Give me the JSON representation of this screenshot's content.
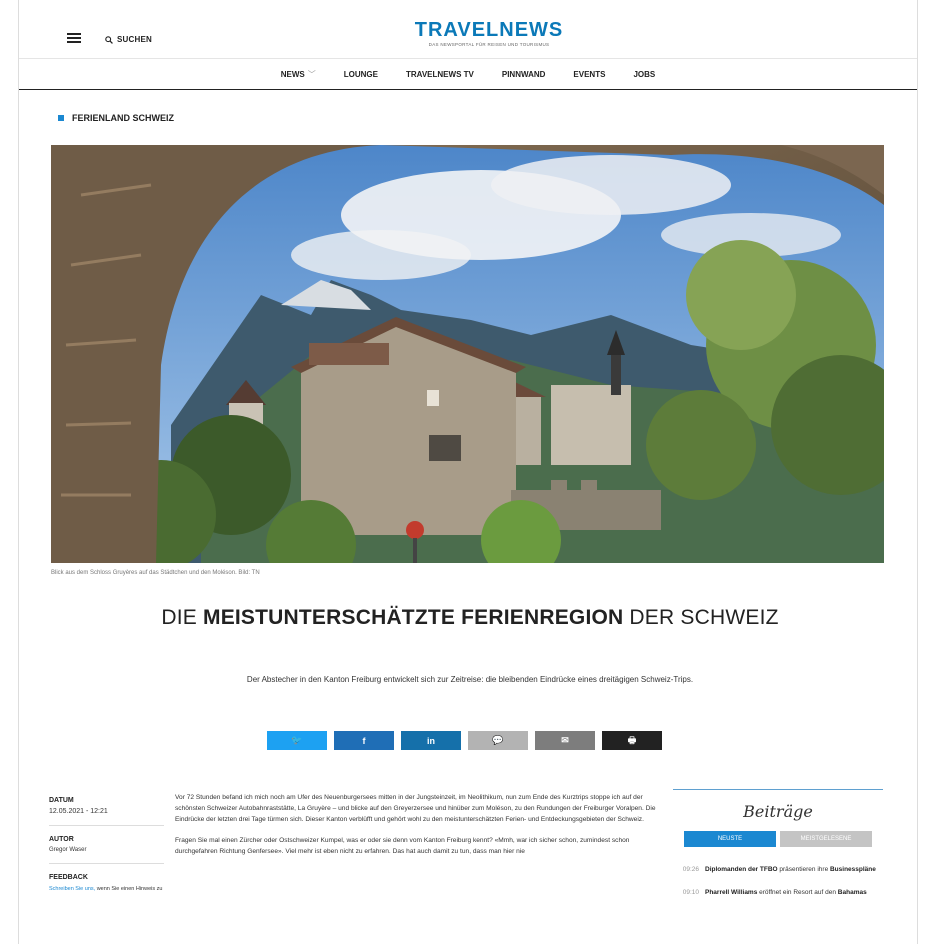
{
  "header": {
    "search_label": "SUCHEN",
    "logo_text": "TRAVELNEWS",
    "logo_sub": "DAS NEWSPORTAL FÜR REISEN UND TOURISMUS"
  },
  "nav": {
    "items": [
      "NEWS",
      "LOUNGE",
      "TRAVELNEWS TV",
      "PINNWAND",
      "EVENTS",
      "JOBS"
    ]
  },
  "section": "FERIENLAND SCHWEIZ",
  "hero": {
    "caption": "Blick aus dem Schloss Gruyères auf das Städtchen und den Moléson. Bild: TN"
  },
  "headline": {
    "pre": "DIE ",
    "strong": "MEISTUNTERSCHÄTZTE FERIENREGION",
    "post": " DER SCHWEIZ"
  },
  "lead": "Der Abstecher in den Kanton Freiburg entwickelt sich zur Zeitreise: die bleibenden Eindrücke eines dreitägigen Schweiz-Trips.",
  "share": {
    "twitter": "🐦",
    "facebook": "f",
    "linkedin": "in",
    "comment": "💬",
    "mail": "✉",
    "print": "🖶",
    "colors": {
      "twitter": "#1da1f2",
      "facebook": "#1f6eb6",
      "linkedin": "#1570aa",
      "comment": "#b3b3b3",
      "mail": "#7d7d7d",
      "print": "#222222"
    }
  },
  "meta": {
    "date_label": "DATUM",
    "date_value": "12.05.2021 - 12:21",
    "author_label": "AUTOR",
    "author_value": "Gregor Waser",
    "feedback_label": "FEEDBACK",
    "feedback_link": "Schreiben Sie uns,",
    "feedback_rest": " wenn Sie einen Hinweis zu"
  },
  "article": {
    "p1": "Vor 72 Stunden befand ich mich noch am Ufer des Neuenburgersees mitten in der Jungsteinzeit, im Neolithikum, nun zum Ende des Kurztrips stoppe ich auf der schönsten Schweizer Autobahnraststätte, La Gruyère – und blicke auf den Greyerzersee und hinüber zum Moléson, zu den Rundungen der Freiburger Voralpen. Die Eindrücke der letzten drei Tage türmen sich. Dieser Kanton verblüfft und gehört wohl zu den meistunterschätzten Ferien- und Entdeckungsgebieten der Schweiz.",
    "p2": "Fragen Sie mal einen Zürcher oder Ostschweizer Kumpel, was er oder sie denn vom Kanton Freiburg kennt? «Mmh, war ich sicher schon, zumindest schon durchgefahren Richtung Genfersee». Viel mehr ist eben nicht zu erfahren. Das hat auch damit zu tun, dass man hier nie"
  },
  "sidebar": {
    "title": "Beiträge",
    "tab_newest": "NEUSTE",
    "tab_most_read": "MEISTGELESENE",
    "tab_colors": {
      "active": "#1b88d1",
      "inactive": "#c4c4c4"
    },
    "news": [
      {
        "time": "09:26",
        "bold": "Diplomanden der TFBO",
        "text": " präsentieren ihre ",
        "bold2": "Businesspläne"
      },
      {
        "time": "09:10",
        "bold": "Pharrell Williams",
        "text": " eröffnet ein Resort auf den ",
        "bold2": "Bahamas"
      }
    ]
  }
}
